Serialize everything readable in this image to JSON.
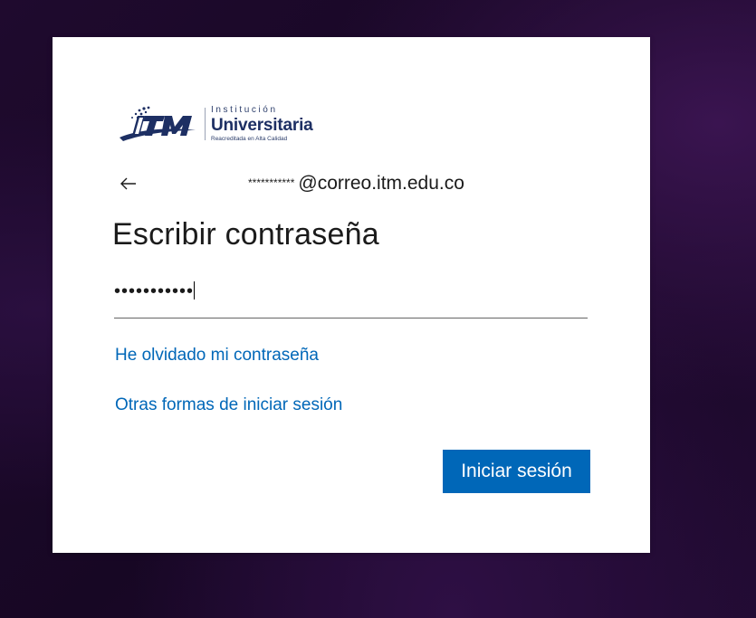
{
  "brand": {
    "mark_text": "ITM",
    "line1": "Institución",
    "line2": "Universitaria",
    "line3": "Reacreditada en Alta Calidad"
  },
  "identity": {
    "masked_user": "***********",
    "domain": "@correo.itm.edu.co"
  },
  "title": "Escribir contraseña",
  "password": {
    "masked_value": "•••••••••••"
  },
  "links": {
    "forgot": "He olvidado mi contraseña",
    "other": "Otras formas de iniciar sesión"
  },
  "actions": {
    "signin_label": "Iniciar sesión"
  },
  "colors": {
    "accent": "#0067b8",
    "brand_navy": "#1d2f63"
  },
  "icons": {
    "back": "arrow-left-icon"
  }
}
